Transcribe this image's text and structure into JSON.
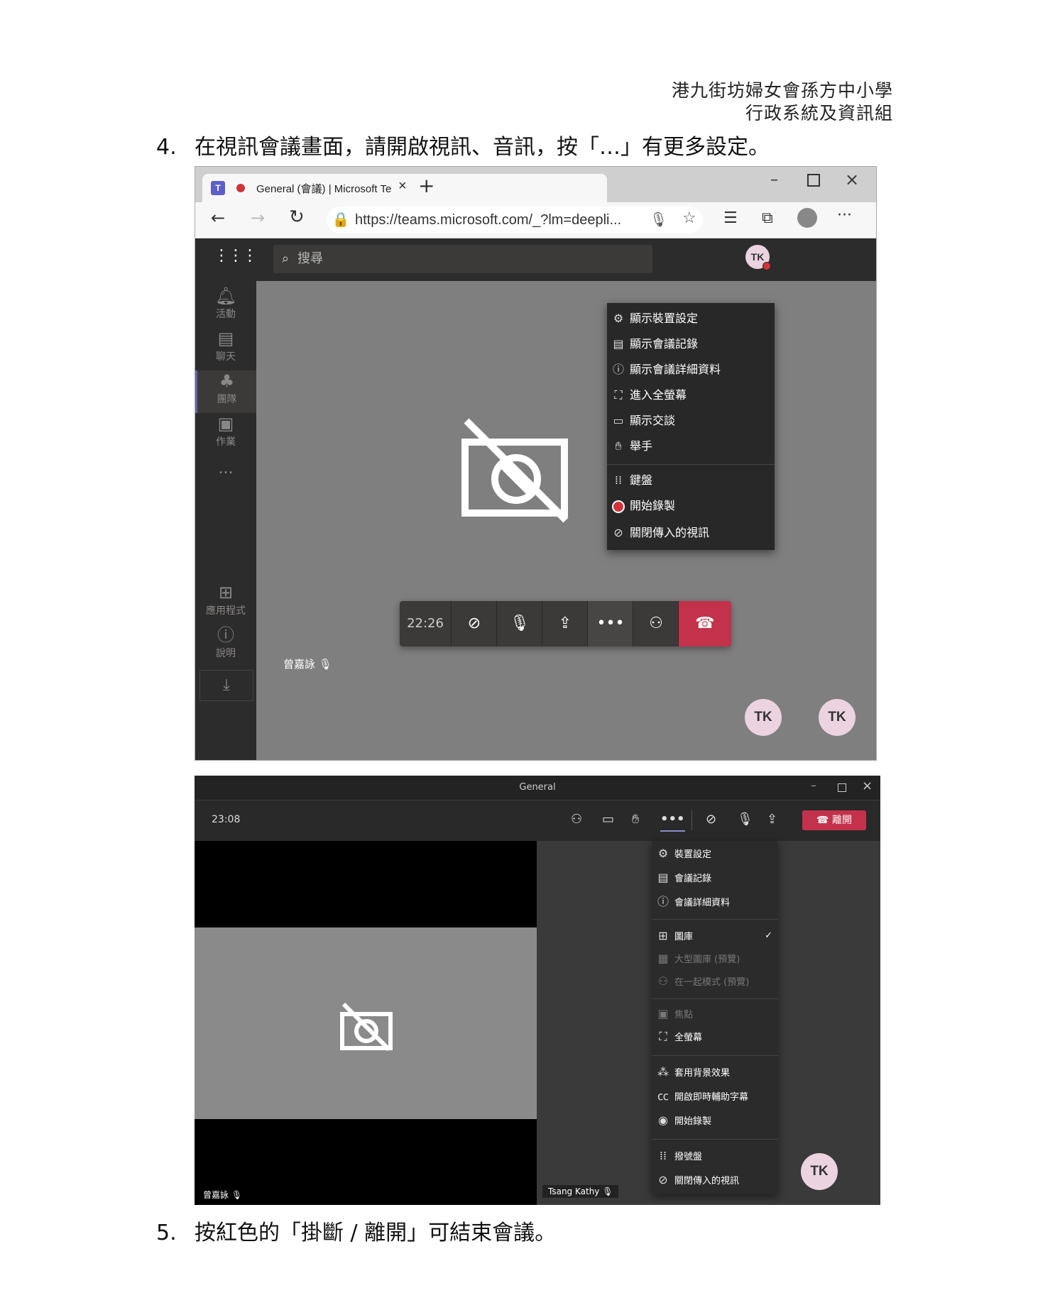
{
  "header": {
    "line1": "港九街坊婦女會孫方中小學",
    "line2": "行政系統及資訊組"
  },
  "step4": {
    "number": "4.",
    "text": "在視訊會議畫面，請開啟視訊、音訊，按「…」有更多設定。"
  },
  "step5": {
    "number": "5.",
    "text": "按紅色的「掛斷 / 離開」可結束會議。"
  },
  "browser": {
    "tab_title": "General (會議) | Microsoft Te",
    "url": "https://teams.microsoft.com/_?lm=deepli...",
    "search_placeholder": "搜尋",
    "avatar_initials": "TK"
  },
  "rail": {
    "items": [
      {
        "label": "活動",
        "icon": "bell-icon"
      },
      {
        "label": "聊天",
        "icon": "chat-icon"
      },
      {
        "label": "團隊",
        "icon": "teams-icon"
      },
      {
        "label": "作業",
        "icon": "assignments-icon"
      },
      {
        "label": "...",
        "icon": "more-icon"
      }
    ],
    "bottom": [
      {
        "label": "應用程式",
        "icon": "apps-icon"
      },
      {
        "label": "說明",
        "icon": "help-icon"
      }
    ]
  },
  "menu1": {
    "items": [
      {
        "label": "顯示裝置設定",
        "icon": "gear-icon"
      },
      {
        "label": "顯示會議記錄",
        "icon": "notes-icon"
      },
      {
        "label": "顯示會議詳細資料",
        "icon": "info-icon"
      },
      {
        "label": "進入全螢幕",
        "icon": "fullscreen-icon"
      },
      {
        "label": "顯示交談",
        "icon": "chat-icon"
      },
      {
        "label": "舉手",
        "icon": "hand-icon"
      },
      {
        "label": "鍵盤",
        "icon": "dialpad-icon"
      },
      {
        "label": "開始錄製",
        "icon": "record-icon"
      },
      {
        "label": "關閉傳入的視訊",
        "icon": "video-off-icon"
      }
    ]
  },
  "meeting1": {
    "timer": "22:26",
    "participant_name": "曾嘉詠",
    "avatars": [
      "TK",
      "TK"
    ]
  },
  "window2": {
    "title": "General",
    "timer": "23:08",
    "leave_label": "離開",
    "participant_left": "曾嘉詠",
    "participant_right": "Tsang Kathy",
    "avatar": "TK"
  },
  "menu2": {
    "group1": [
      {
        "label": "裝置設定",
        "icon": "gear-icon"
      },
      {
        "label": "會議記錄",
        "icon": "notes-icon"
      },
      {
        "label": "會議詳細資料",
        "icon": "info-icon"
      }
    ],
    "group2": [
      {
        "label": "圖庫",
        "icon": "gallery-icon",
        "checked": true
      },
      {
        "label": "大型圖庫 (預覽)",
        "icon": "large-gallery-icon",
        "disabled": true
      },
      {
        "label": "在一起模式 (預覽)",
        "icon": "together-icon",
        "disabled": true
      }
    ],
    "group3": [
      {
        "label": "焦點",
        "icon": "focus-icon",
        "disabled": true
      },
      {
        "label": "全螢幕",
        "icon": "fullscreen-icon"
      }
    ],
    "group4": [
      {
        "label": "套用背景效果",
        "icon": "background-icon"
      },
      {
        "label": "開啟即時輔助字幕",
        "icon": "captions-icon"
      },
      {
        "label": "開始錄製",
        "icon": "record-icon"
      }
    ],
    "group5": [
      {
        "label": "撥號盤",
        "icon": "dialpad-icon"
      },
      {
        "label": "關閉傳入的視訊",
        "icon": "video-off-icon"
      }
    ]
  }
}
